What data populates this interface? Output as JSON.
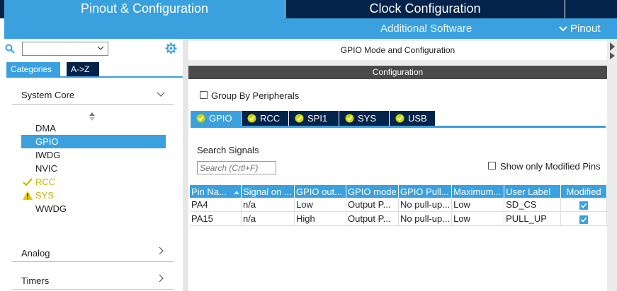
{
  "top_tabs": {
    "pinout": "Pinout & Configuration",
    "clock": "Clock Configuration"
  },
  "subbar": {
    "additional_software": "Additional Software",
    "pinout": "Pinout"
  },
  "sidebar": {
    "search_value": "",
    "tabs": {
      "categories": "Categories",
      "az": "A->Z"
    },
    "sections": [
      {
        "label": "System Core"
      },
      {
        "label": "Analog"
      },
      {
        "label": "Timers"
      }
    ],
    "items": [
      {
        "label": "DMA",
        "state": "none"
      },
      {
        "label": "GPIO",
        "state": "selected"
      },
      {
        "label": "IWDG",
        "state": "none"
      },
      {
        "label": "NVIC",
        "state": "none"
      },
      {
        "label": "RCC",
        "state": "ok"
      },
      {
        "label": "SYS",
        "state": "warning"
      },
      {
        "label": "WWDG",
        "state": "none"
      }
    ]
  },
  "main": {
    "mode_title": "GPIO Mode and Configuration",
    "config_title": "Configuration",
    "group_by_label": "Group By Peripherals",
    "peripheral_tabs": [
      {
        "label": "GPIO",
        "active": true
      },
      {
        "label": "RCC",
        "active": false
      },
      {
        "label": "SPI1",
        "active": false
      },
      {
        "label": "SYS",
        "active": false
      },
      {
        "label": "USB",
        "active": false
      }
    ],
    "search_signals_label": "Search Signals",
    "search_placeholder": "Search (Crtl+F)",
    "show_modified_label": "Show only Modified Pins",
    "table": {
      "headers": [
        "Pin Na...",
        "Signal on ...",
        "GPIO out...",
        "GPIO mode",
        "GPIO Pull...",
        "Maximum...",
        "User Label",
        "Modified"
      ],
      "rows": [
        [
          "PA4",
          "n/a",
          "Low",
          "Output P...",
          "No pull-up...",
          "Low",
          "SD_CS",
          true
        ],
        [
          "PA15",
          "n/a",
          "High",
          "Output P...",
          "No pull-up...",
          "Low",
          "PULL_UP",
          true
        ]
      ]
    }
  },
  "colors": {
    "accent": "#3aa1de",
    "dark": "#03234b",
    "ok": "#c9b800"
  }
}
